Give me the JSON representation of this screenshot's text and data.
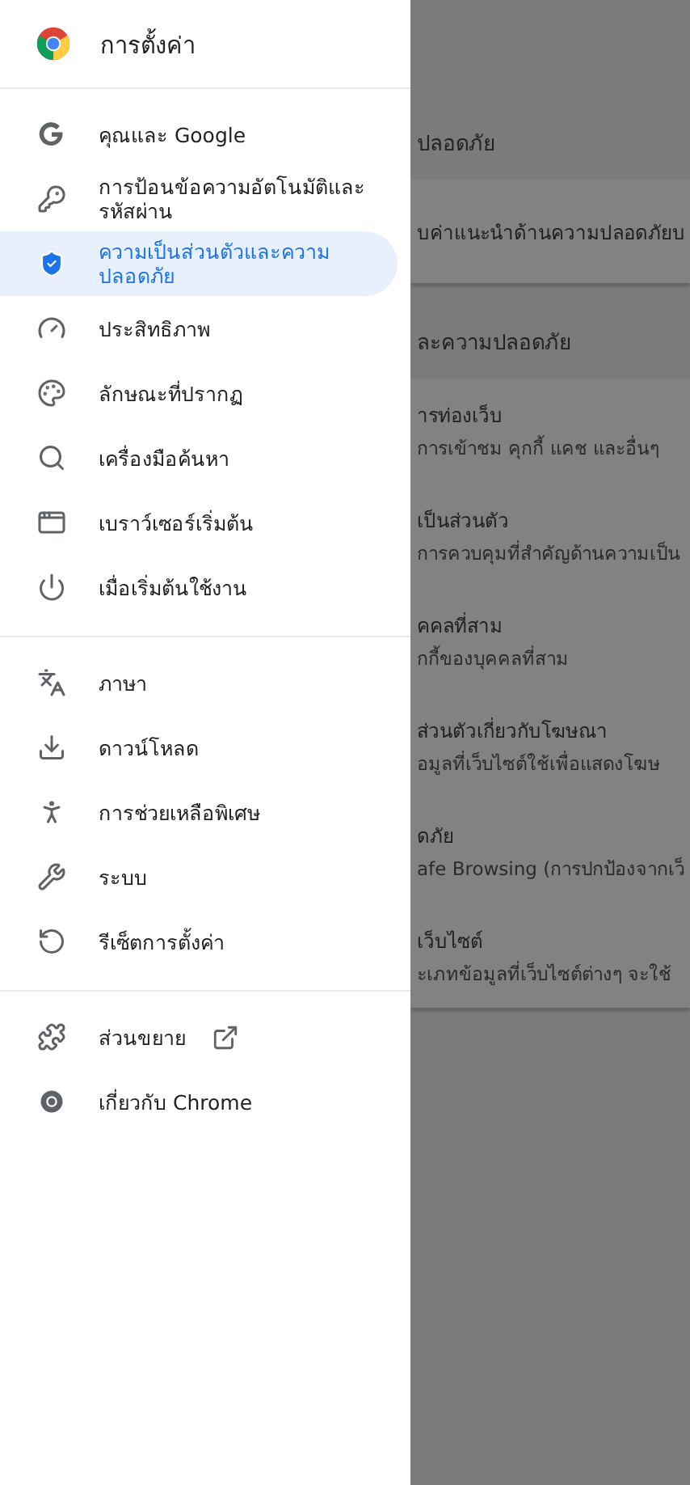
{
  "drawer": {
    "title": "การตั้งค่า",
    "groups": [
      {
        "items": [
          {
            "label": "คุณและ Google",
            "selected": false
          },
          {
            "label": "การป้อนข้อความอัตโนมัติและรหัสผ่าน",
            "selected": false
          },
          {
            "label": "ความเป็นส่วนตัวและความปลอดภัย",
            "selected": true
          },
          {
            "label": "ประสิทธิภาพ",
            "selected": false
          },
          {
            "label": "ลักษณะที่ปรากฏ",
            "selected": false
          },
          {
            "label": "เครื่องมือค้นหา",
            "selected": false
          },
          {
            "label": "เบราว์เซอร์เริ่มต้น",
            "selected": false
          },
          {
            "label": "เมื่อเริ่มต้นใช้งาน",
            "selected": false
          }
        ]
      },
      {
        "items": [
          {
            "label": "ภาษา",
            "selected": false
          },
          {
            "label": "ดาวน์โหลด",
            "selected": false
          },
          {
            "label": "การช่วยเหลือพิเศษ",
            "selected": false
          },
          {
            "label": "ระบบ",
            "selected": false
          },
          {
            "label": "รีเซ็ตการตั้งค่า",
            "selected": false
          }
        ]
      },
      {
        "items": [
          {
            "label": "ส่วนขยาย",
            "selected": false,
            "external": true
          },
          {
            "label": "เกี่ยวกับ Chrome",
            "selected": false
          }
        ]
      }
    ]
  },
  "background": {
    "sections": [
      {
        "title": "ปลอดภัย",
        "rows": [
          {
            "title": "บค่าแนะนำด้านความปลอดภัยบ"
          }
        ]
      },
      {
        "title": "ละความปลอดภัย",
        "rows": [
          {
            "title": "ารท่องเว็บ",
            "subtitle": "การเข้าชม คุกกี้ แคช และอื่นๆ"
          },
          {
            "title": "เป็นส่วนตัว",
            "subtitle": "การควบคุมที่สำคัญด้านความเป็น"
          },
          {
            "title": "คคลที่สาม",
            "subtitle": "กกี้ของบุคคลที่สาม"
          },
          {
            "title": "ส่วนตัวเกี่ยวกับโฆษณา",
            "subtitle": "อมูลที่เว็บไซต์ใช้เพื่อแสดงโฆษ"
          },
          {
            "title": "ดภัย",
            "subtitle": "afe Browsing (การปกป้องจากเว็"
          },
          {
            "title": "เว็บไซต์",
            "subtitle": "ะเภทข้อมูลที่เว็บไซต์ต่างๆ จะใช้"
          }
        ]
      }
    ]
  }
}
